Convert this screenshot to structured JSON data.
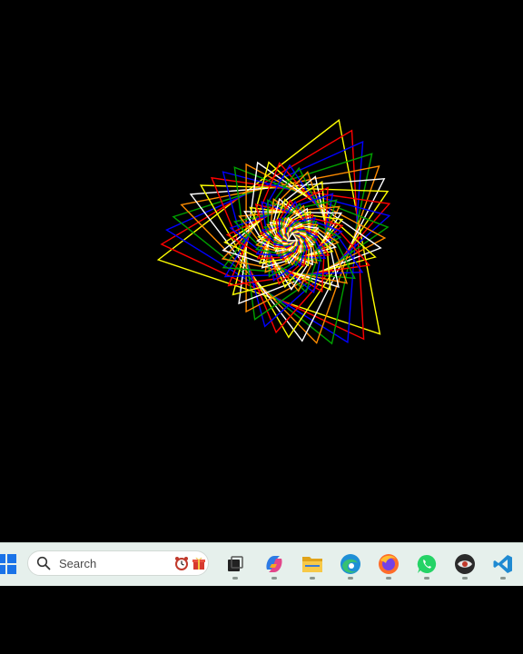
{
  "canvas": {
    "background": "#000000",
    "line_colors": [
      "#ffff00",
      "#ff0000",
      "#0000ff",
      "#00a000",
      "#ff8c00",
      "#ffffff"
    ]
  },
  "taskbar": {
    "background": "#e6f0ec",
    "search": {
      "label": "Search"
    },
    "icons": [
      "windows-start-icon",
      "search-icon",
      "alarm-clock-icon",
      "gift-icon",
      "task-view-icon",
      "copilot-icon",
      "file-explorer-icon",
      "edge-browser-icon",
      "firefox-icon",
      "whatsapp-icon",
      "eye-app-icon",
      "vscode-icon"
    ]
  }
}
